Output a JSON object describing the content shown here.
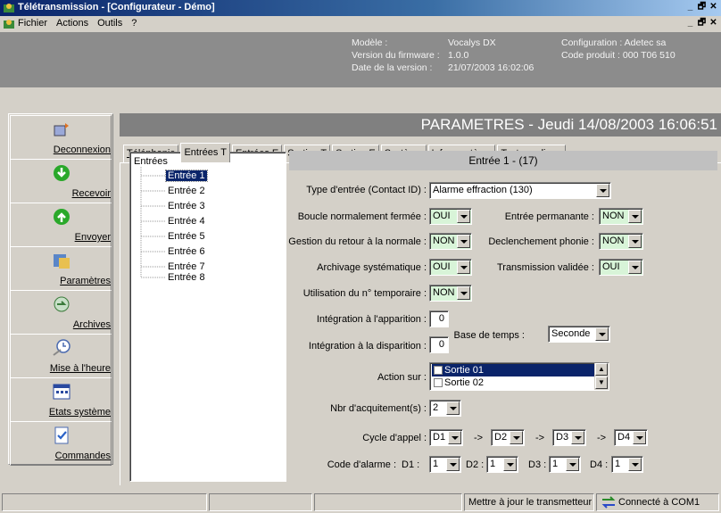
{
  "window": {
    "title": "Télétransmission - [Configurateur - Démo]",
    "min_label": "_",
    "max_label": "🗗",
    "close_label": "✕"
  },
  "menu": {
    "items": [
      "Fichier",
      "Actions",
      "Outils",
      "?"
    ]
  },
  "info": {
    "model_label": "Modèle :",
    "model_value": "Vocalys DX",
    "firmware_label": "Version du firmware :",
    "firmware_value": "1.0.0",
    "date_label": "Date de la version :",
    "date_value": "21/07/2003 16:02:06",
    "config_label": "Configuration :",
    "config_value": "Adetec sa",
    "product_label": "Code produit :",
    "product_value": "000 T06 510"
  },
  "nav": {
    "items": [
      {
        "label": "Deconnexion",
        "icon": "disconnect-icon"
      },
      {
        "label": "Recevoir",
        "icon": "down-arrow-circle-icon"
      },
      {
        "label": "Envoyer",
        "icon": "up-arrow-circle-icon"
      },
      {
        "label": "Paramètres",
        "icon": "parameters-icon"
      },
      {
        "label": "Archives",
        "icon": "archives-icon"
      },
      {
        "label": "Mise à l'heure",
        "icon": "clock-icon"
      },
      {
        "label": "Etats système",
        "icon": "system-status-icon"
      },
      {
        "label": "Commandes",
        "icon": "commands-icon"
      }
    ]
  },
  "header": {
    "title": "PARAMETRES - Jeudi 14/08/2003 16:06:51"
  },
  "tabs": [
    {
      "label": "Téléphonie"
    },
    {
      "label": "Entrées T"
    },
    {
      "label": "Entrées E"
    },
    {
      "label": "Sorties T"
    },
    {
      "label": "Sorties E"
    },
    {
      "label": "Système"
    },
    {
      "label": "Infos système"
    },
    {
      "label": "Tests cyclique"
    }
  ],
  "tree": {
    "root": "Entrées",
    "items": [
      "Entrée 1",
      "Entrée 2",
      "Entrée 3",
      "Entrée 4",
      "Entrée 5",
      "Entrée 6",
      "Entrée 7",
      "Entrée 8"
    ]
  },
  "form": {
    "heading": "Entrée 1 - (17)",
    "type_label": "Type d'entrée (Contact ID) :",
    "type_value": "Alarme effraction (130)",
    "boucle_label": "Boucle normalement fermée :",
    "boucle_value": "OUI",
    "permanente_label": "Entrée permanante :",
    "permanente_value": "NON",
    "retour_label": "Gestion du retour à la normale :",
    "retour_value": "NON",
    "phonie_label": "Declenchement phonie :",
    "phonie_value": "NON",
    "archivage_label": "Archivage systématique :",
    "archivage_value": "OUI",
    "transmission_label": "Transmission validée :",
    "transmission_value": "OUI",
    "temporaire_label": "Utilisation du n° temporaire :",
    "temporaire_value": "NON",
    "apparition_label": "Intégration à l'apparition :",
    "apparition_value": "0",
    "disparition_label": "Intégration à la disparition :",
    "disparition_value": "0",
    "base_label": "Base de temps :",
    "base_value": "Seconde",
    "action_label": "Action sur :",
    "action_items": [
      "Sortie 01",
      "Sortie 02"
    ],
    "acquit_label": "Nbr d'acquitement(s) :",
    "acquit_value": "2",
    "cycle_label": "Cycle d'appel :",
    "cycle_values": [
      "D1",
      "D2",
      "D3",
      "D4"
    ],
    "cycle_arrow": "->",
    "alarm_label": "Code d'alarme :",
    "alarm_d_labels": [
      "D1 :",
      "D2 :",
      "D3 :",
      "D4 :"
    ],
    "alarm_values": [
      "1",
      "1",
      "1",
      "1"
    ]
  },
  "status": {
    "update_label": "Mettre à jour le transmetteur",
    "connection_label": "Connecté à COM1"
  }
}
